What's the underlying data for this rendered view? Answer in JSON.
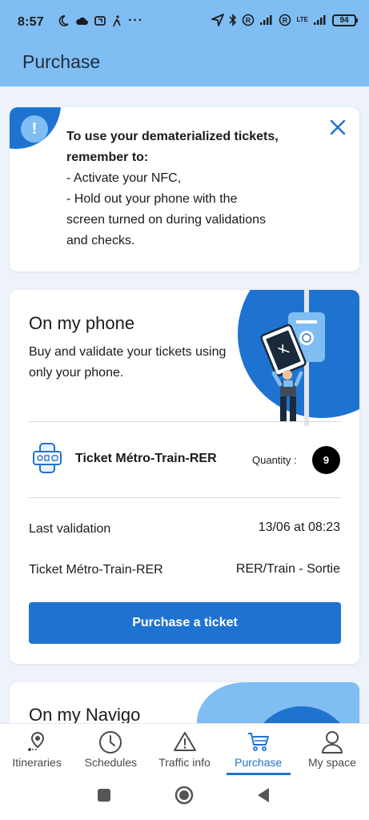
{
  "status_bar": {
    "time": "8:57",
    "more": "···",
    "lte": "LTE",
    "battery": "94"
  },
  "header": {
    "title": "Purchase"
  },
  "info_card": {
    "bang": "!",
    "title_line1": "To use your dematerialized tickets,",
    "title_line2": "remember to:",
    "line3": "- Activate your NFC,",
    "line4": "- Hold out your phone with the",
    "line5": "screen turned on during validations",
    "line6": "and checks."
  },
  "phone_card": {
    "title": "On my phone",
    "subtitle": "Buy and validate your tickets using only your phone.",
    "ticket_name": "Ticket Métro-Train-RER",
    "quantity_label": "Quantity :",
    "quantity": "9",
    "last_validation_label": "Last validation",
    "last_validation_value": "13/06 at 08:23",
    "validated_ticket_label": "Ticket Métro-Train-RER",
    "validated_ticket_value": "RER/Train - Sortie",
    "button_label": "Purchase a ticket"
  },
  "navigo_card": {
    "title": "On my Navigo"
  },
  "bottom_nav": {
    "itineraries": "Itineraries",
    "schedules": "Schedules",
    "traffic_info": "Traffic info",
    "purchase": "Purchase",
    "my_space": "My space"
  },
  "colors": {
    "header_bg": "#7fbdf3",
    "primary": "#1f73d0",
    "page_bg": "#eef3fb"
  }
}
